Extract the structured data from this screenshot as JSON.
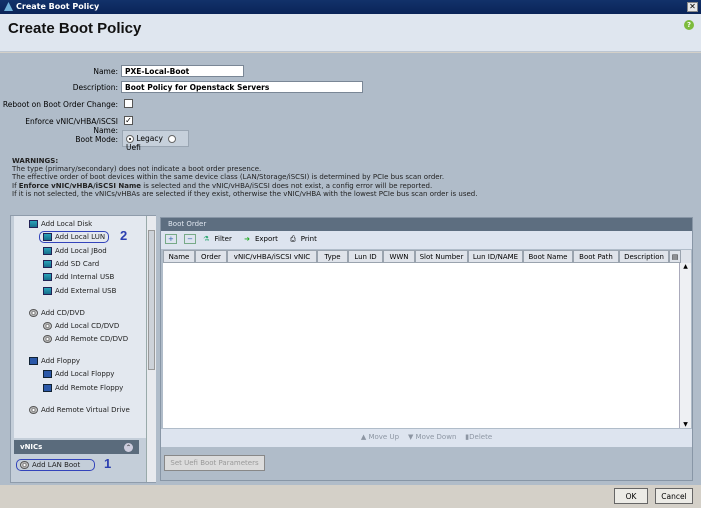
{
  "window": {
    "title": "Create Boot Policy",
    "close": "✕"
  },
  "header": {
    "title": "Create Boot Policy",
    "help": "?"
  },
  "form": {
    "name_label": "Name:",
    "name_value": "PXE-Local-Boot",
    "description_label": "Description:",
    "description_value": "Boot Policy for Openstack Servers",
    "reboot_label": "Reboot on Boot Order Change:",
    "reboot_checked": false,
    "enforce_label": "Enforce vNIC/vHBA/iSCSI Name:",
    "enforce_checked": true,
    "boot_mode_label": "Boot Mode:",
    "boot_mode_options": [
      "Legacy",
      "Uefi"
    ],
    "boot_mode_selected": "Legacy"
  },
  "warnings": {
    "title": "WARNINGS:",
    "line1": "The type (primary/secondary) does not indicate a boot order presence.",
    "line2": "The effective order of boot devices within the same device class (LAN/Storage/iSCSI) is determined by PCIe bus scan order.",
    "line3_prefix": "If ",
    "line3_bold": "Enforce vNIC/vHBA/iSCSI Name",
    "line3_suffix": " is selected and the vNIC/vHBA/iSCSI does not exist, a config error will be reported.",
    "line4": "If it is not selected, the vNICs/vHBAs are selected if they exist, otherwise the vNIC/vHBA with the lowest PCIe bus scan order is used."
  },
  "left": {
    "items": [
      "Add Local Disk",
      "Add Local LUN",
      "Add Local JBod",
      "Add SD Card",
      "Add Internal USB",
      "Add External USB",
      "Add CD/DVD",
      "Add Local CD/DVD",
      "Add Remote CD/DVD",
      "Add Floppy",
      "Add Local Floppy",
      "Add Remote Floppy",
      "Add Remote Virtual Drive"
    ],
    "vnics_title": "vNICs",
    "add_lan_boot": "Add LAN Boot",
    "annotation_1": "1",
    "annotation_2": "2"
  },
  "boot_order": {
    "title": "Boot Order",
    "toolbar": {
      "add": "+",
      "remove": "−",
      "filter": "Filter",
      "export": "Export",
      "print": "Print"
    },
    "columns": [
      "Name",
      "Order",
      "vNIC/vHBA/iSCSI vNIC",
      "Type",
      "Lun ID",
      "WWN",
      "Slot Number",
      "Lun ID/NAME",
      "Boot Name",
      "Boot Path",
      "Description"
    ],
    "rows": [],
    "move_up": "Move Up",
    "move_down": "Move Down",
    "delete": "Delete",
    "uefi_button": "Set Uefi Boot Parameters"
  },
  "footer": {
    "ok": "OK",
    "cancel": "Cancel"
  }
}
